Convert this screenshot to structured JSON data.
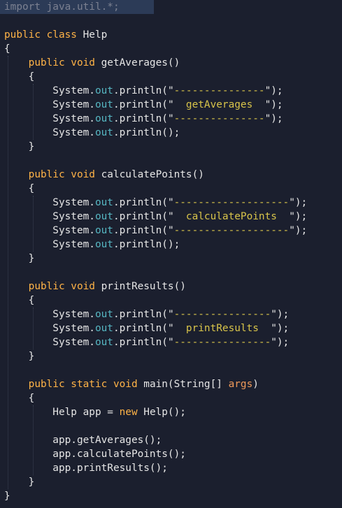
{
  "editor": {
    "language": "Java",
    "selected_line_index": 0,
    "lines": [
      [
        {
          "t": "import java.util.*;",
          "c": "dim"
        }
      ],
      [],
      [
        {
          "t": "public class ",
          "c": "kw"
        },
        {
          "t": "Help",
          "c": "pl"
        }
      ],
      [
        {
          "t": "{",
          "c": "pl"
        }
      ],
      [
        {
          "t": "    ",
          "c": "pl"
        },
        {
          "t": "public void ",
          "c": "kw"
        },
        {
          "t": "getAverages()",
          "c": "pl"
        }
      ],
      [
        {
          "t": "    {",
          "c": "pl"
        }
      ],
      [
        {
          "t": "        System.",
          "c": "pl"
        },
        {
          "t": "out",
          "c": "fld"
        },
        {
          "t": ".println(\"",
          "c": "pl"
        },
        {
          "t": "---------------",
          "c": "str"
        },
        {
          "t": "\");",
          "c": "pl"
        }
      ],
      [
        {
          "t": "        System.",
          "c": "pl"
        },
        {
          "t": "out",
          "c": "fld"
        },
        {
          "t": ".println(\"",
          "c": "pl"
        },
        {
          "t": "  getAverages  ",
          "c": "str"
        },
        {
          "t": "\");",
          "c": "pl"
        }
      ],
      [
        {
          "t": "        System.",
          "c": "pl"
        },
        {
          "t": "out",
          "c": "fld"
        },
        {
          "t": ".println(\"",
          "c": "pl"
        },
        {
          "t": "---------------",
          "c": "str"
        },
        {
          "t": "\");",
          "c": "pl"
        }
      ],
      [
        {
          "t": "        System.",
          "c": "pl"
        },
        {
          "t": "out",
          "c": "fld"
        },
        {
          "t": ".println();",
          "c": "pl"
        }
      ],
      [
        {
          "t": "    }",
          "c": "pl"
        }
      ],
      [],
      [
        {
          "t": "    ",
          "c": "pl"
        },
        {
          "t": "public void ",
          "c": "kw"
        },
        {
          "t": "calculatePoints()",
          "c": "pl"
        }
      ],
      [
        {
          "t": "    {",
          "c": "pl"
        }
      ],
      [
        {
          "t": "        System.",
          "c": "pl"
        },
        {
          "t": "out",
          "c": "fld"
        },
        {
          "t": ".println(\"",
          "c": "pl"
        },
        {
          "t": "-------------------",
          "c": "str"
        },
        {
          "t": "\");",
          "c": "pl"
        }
      ],
      [
        {
          "t": "        System.",
          "c": "pl"
        },
        {
          "t": "out",
          "c": "fld"
        },
        {
          "t": ".println(\"",
          "c": "pl"
        },
        {
          "t": "  calculatePoints  ",
          "c": "str"
        },
        {
          "t": "\");",
          "c": "pl"
        }
      ],
      [
        {
          "t": "        System.",
          "c": "pl"
        },
        {
          "t": "out",
          "c": "fld"
        },
        {
          "t": ".println(\"",
          "c": "pl"
        },
        {
          "t": "-------------------",
          "c": "str"
        },
        {
          "t": "\");",
          "c": "pl"
        }
      ],
      [
        {
          "t": "        System.",
          "c": "pl"
        },
        {
          "t": "out",
          "c": "fld"
        },
        {
          "t": ".println();",
          "c": "pl"
        }
      ],
      [
        {
          "t": "    }",
          "c": "pl"
        }
      ],
      [],
      [
        {
          "t": "    ",
          "c": "pl"
        },
        {
          "t": "public void ",
          "c": "kw"
        },
        {
          "t": "printResults()",
          "c": "pl"
        }
      ],
      [
        {
          "t": "    {",
          "c": "pl"
        }
      ],
      [
        {
          "t": "        System.",
          "c": "pl"
        },
        {
          "t": "out",
          "c": "fld"
        },
        {
          "t": ".println(\"",
          "c": "pl"
        },
        {
          "t": "----------------",
          "c": "str"
        },
        {
          "t": "\");",
          "c": "pl"
        }
      ],
      [
        {
          "t": "        System.",
          "c": "pl"
        },
        {
          "t": "out",
          "c": "fld"
        },
        {
          "t": ".println(\"",
          "c": "pl"
        },
        {
          "t": "  printResults  ",
          "c": "str"
        },
        {
          "t": "\");",
          "c": "pl"
        }
      ],
      [
        {
          "t": "        System.",
          "c": "pl"
        },
        {
          "t": "out",
          "c": "fld"
        },
        {
          "t": ".println(\"",
          "c": "pl"
        },
        {
          "t": "----------------",
          "c": "str"
        },
        {
          "t": "\");",
          "c": "pl"
        }
      ],
      [
        {
          "t": "    }",
          "c": "pl"
        }
      ],
      [],
      [
        {
          "t": "    ",
          "c": "pl"
        },
        {
          "t": "public static void ",
          "c": "kw"
        },
        {
          "t": "main(String[] ",
          "c": "pl"
        },
        {
          "t": "args",
          "c": "arg"
        },
        {
          "t": ")",
          "c": "pl"
        }
      ],
      [
        {
          "t": "    {",
          "c": "pl"
        }
      ],
      [
        {
          "t": "        Help app = ",
          "c": "pl"
        },
        {
          "t": "new ",
          "c": "kw"
        },
        {
          "t": "Help();",
          "c": "pl"
        }
      ],
      [],
      [
        {
          "t": "        app.getAverages();",
          "c": "pl"
        }
      ],
      [
        {
          "t": "        app.calculatePoints();",
          "c": "pl"
        }
      ],
      [
        {
          "t": "        app.printResults();",
          "c": "pl"
        }
      ],
      [
        {
          "t": "    }",
          "c": "pl"
        }
      ],
      [
        {
          "t": "}",
          "c": "pl"
        }
      ]
    ]
  },
  "colors": {
    "background": "#1b1f2e",
    "selection": "#2c3b57",
    "plain": "#e6e6e6",
    "keyword": "#ffb347",
    "string": "#d8c44a",
    "field": "#56b6c2",
    "parameter": "#f09a5a",
    "comment_dim": "#7c8191"
  }
}
